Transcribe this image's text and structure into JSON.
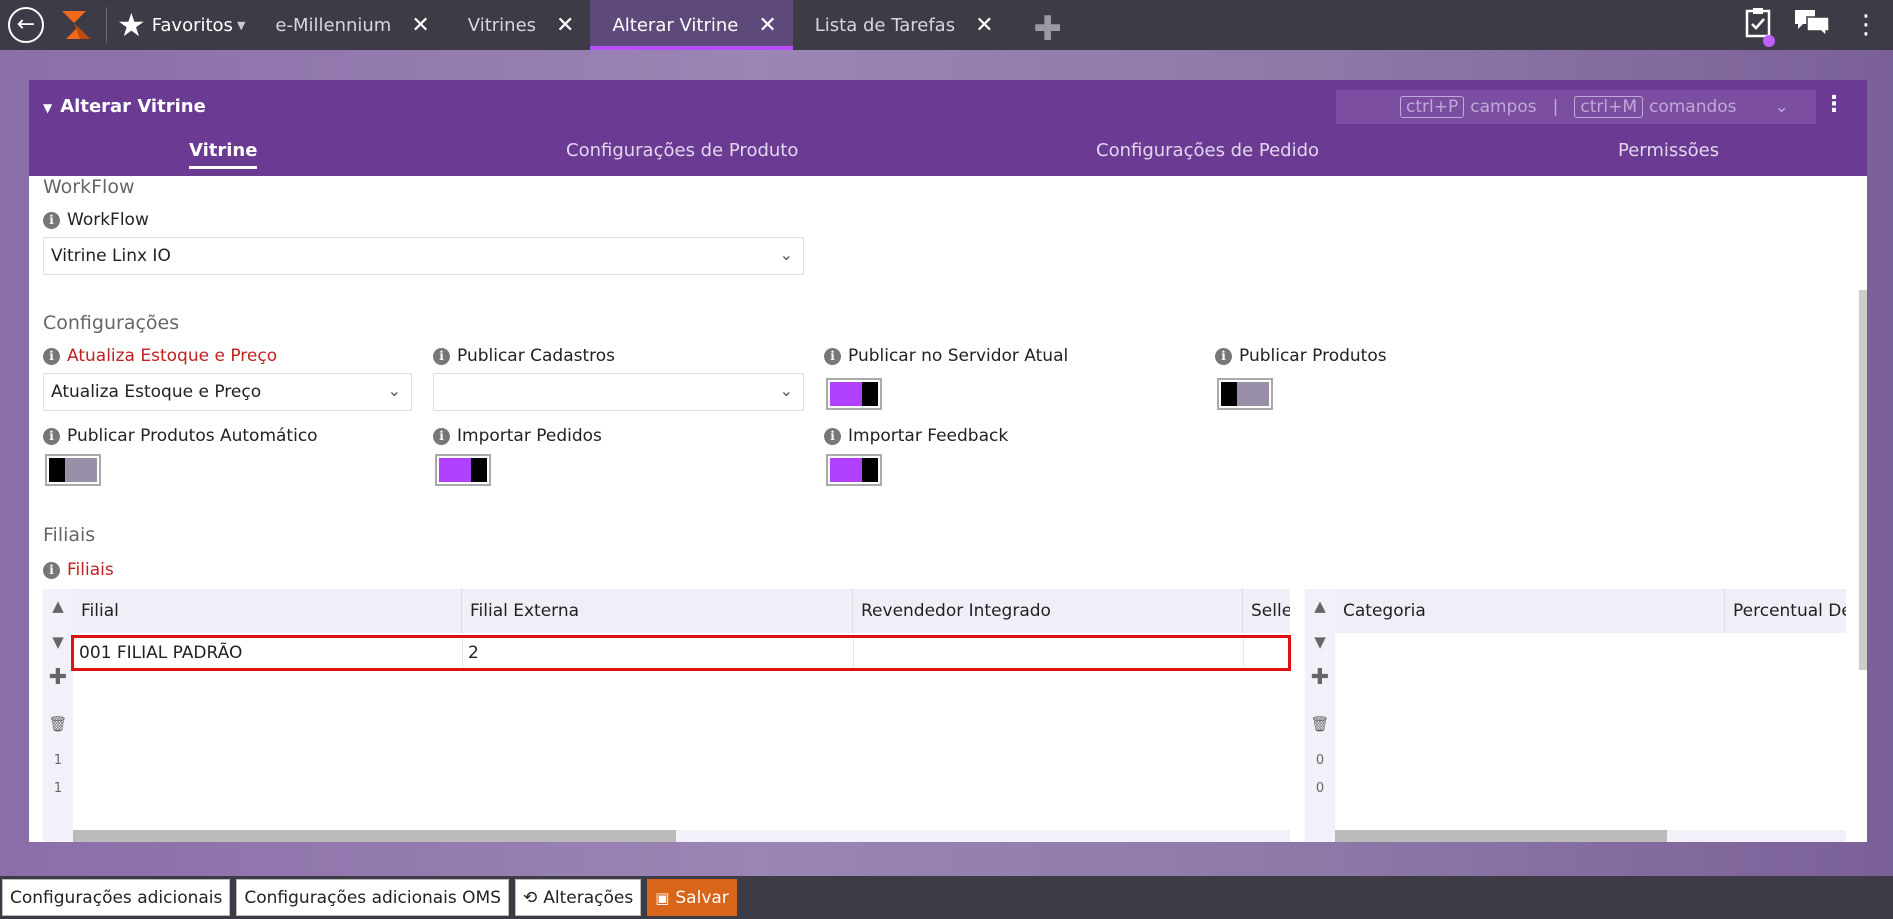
{
  "topbar": {
    "favorites_label": "Favoritos",
    "tabs": [
      {
        "label": "e-Millennium",
        "active": false
      },
      {
        "label": "Vitrines",
        "active": false
      },
      {
        "label": "Alterar Vitrine",
        "active": true
      },
      {
        "label": "Lista de Tarefas",
        "active": false
      }
    ],
    "accent_color": "#b84cff"
  },
  "panel": {
    "title": "Alterar Vitrine",
    "shortcut_fields_key": "ctrl+P",
    "shortcut_fields_label": "campos",
    "shortcut_commands_key": "ctrl+M",
    "shortcut_commands_label": "comandos",
    "separator": "|",
    "tabs": [
      {
        "label": "Vitrine",
        "active": true
      },
      {
        "label": "Configurações de Produto",
        "active": false
      },
      {
        "label": "Configurações de Pedido",
        "active": false
      },
      {
        "label": "Permissões",
        "active": false
      }
    ],
    "header_color": "#6b3a93"
  },
  "workflow": {
    "section": "WorkFlow",
    "label": "WorkFlow",
    "value": "Vitrine Linx IO"
  },
  "config": {
    "section": "Configurações",
    "atualiza_label": "Atualiza Estoque e Preço",
    "atualiza_value": "Atualiza Estoque e Preço",
    "publicar_cadastros_label": "Publicar Cadastros",
    "publicar_cadastros_value": "",
    "publicar_servidor_label": "Publicar no Servidor Atual",
    "publicar_servidor_on": true,
    "publicar_produtos_label": "Publicar Produtos",
    "publicar_produtos_on": false,
    "publicar_auto_label": "Publicar Produtos Automático",
    "publicar_auto_on": false,
    "importar_pedidos_label": "Importar Pedidos",
    "importar_pedidos_on": true,
    "importar_feedback_label": "Importar Feedback",
    "importar_feedback_on": true
  },
  "filiais": {
    "section": "Filiais",
    "label": "Filiais",
    "columns": [
      "Filial",
      "Filial Externa",
      "Revendedor Integrado",
      "Selle"
    ],
    "rows": [
      {
        "filial": "001 FILIAL PADRÃO",
        "filial_externa": "2",
        "revendedor": "",
        "seller": ""
      }
    ],
    "count_a": "1",
    "count_b": "1",
    "right_columns": [
      "Categoria",
      "Percentual De"
    ],
    "right_count_a": "0",
    "right_count_b": "0"
  },
  "bottombar": {
    "btn1": "Configurações adicionais",
    "btn2": "Configurações adicionais OMS",
    "btn3": "Alterações",
    "btn4": "Salvar",
    "save_color": "#d9651a"
  }
}
